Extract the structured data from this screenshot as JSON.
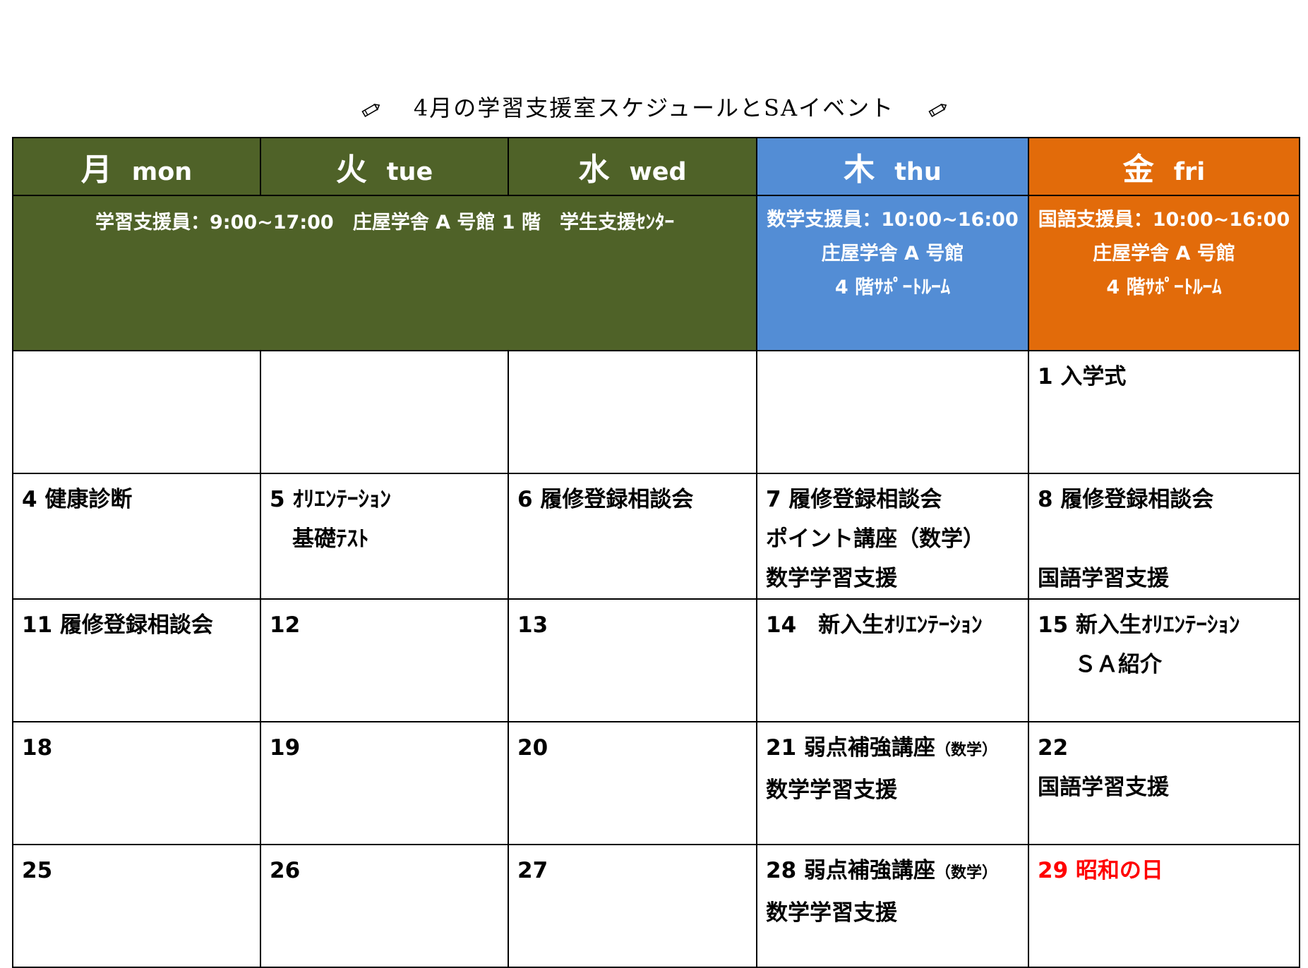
{
  "title": "4月の学習支援室スケジュールとSAイベント",
  "days": [
    {
      "kanji": "月",
      "en": "mon"
    },
    {
      "kanji": "火",
      "en": "tue"
    },
    {
      "kanji": "水",
      "en": "wed"
    },
    {
      "kanji": "木",
      "en": "thu"
    },
    {
      "kanji": "金",
      "en": "fri"
    }
  ],
  "info": {
    "general": "学習支援員：9:00~17:00　庄屋学舎 A 号館 1 階　学生支援ｾﾝﾀｰ",
    "thu": [
      "数学支援員：10:00~16:00",
      "庄屋学舎 A 号館",
      "4 階ｻﾎﾟｰﾄﾙｰﾑ"
    ],
    "fri": [
      "国語支援員：10:00~16:00",
      "庄屋学舎 A 号館",
      "4 階ｻﾎﾟｰﾄﾙｰﾑ"
    ]
  },
  "weeks": [
    [
      {
        "lines": []
      },
      {
        "lines": []
      },
      {
        "lines": []
      },
      {
        "lines": []
      },
      {
        "lines": [
          "1 入学式"
        ]
      }
    ],
    [
      {
        "lines": [
          "4 健康診断"
        ]
      },
      {
        "lines": [
          "5 ｵﾘｴﾝﾃｰｼｮﾝ",
          "基礎ﾃｽﾄ"
        ]
      },
      {
        "lines": [
          "6 履修登録相談会"
        ]
      },
      {
        "lines": [
          "7 履修登録相談会",
          "ポイント講座（数学）",
          "数学学習支援"
        ]
      },
      {
        "lines": [
          "8 履修登録相談会",
          "",
          "国語学習支援"
        ]
      }
    ],
    [
      {
        "lines": [
          "11 履修登録相談会"
        ]
      },
      {
        "lines": [
          "12"
        ]
      },
      {
        "lines": [
          "13"
        ]
      },
      {
        "lines": [
          "14　新入生ｵﾘｴﾝﾃｰｼｮﾝ"
        ]
      },
      {
        "lines": [
          "15 新入生ｵﾘｴﾝﾃｰｼｮﾝ",
          "ＳＡ紹介"
        ]
      }
    ],
    [
      {
        "lines": [
          "18"
        ]
      },
      {
        "lines": [
          "19"
        ]
      },
      {
        "lines": [
          "20"
        ]
      },
      {
        "lines": [
          "21 弱点補強講座",
          "（数学）",
          "数学学習支援"
        ]
      },
      {
        "lines": [
          "22",
          "国語学習支援"
        ]
      }
    ],
    [
      {
        "lines": [
          "25"
        ]
      },
      {
        "lines": [
          "26"
        ]
      },
      {
        "lines": [
          "27"
        ]
      },
      {
        "lines": [
          "28 弱点補強講座",
          "（数学）",
          "数学学習支援"
        ]
      },
      {
        "lines": [
          "29 昭和の日"
        ]
      }
    ]
  ],
  "colors": {
    "mon_wed": "#4f6228",
    "thu": "#538dd5",
    "fri": "#e26b0a",
    "holiday": "#ff0000"
  }
}
